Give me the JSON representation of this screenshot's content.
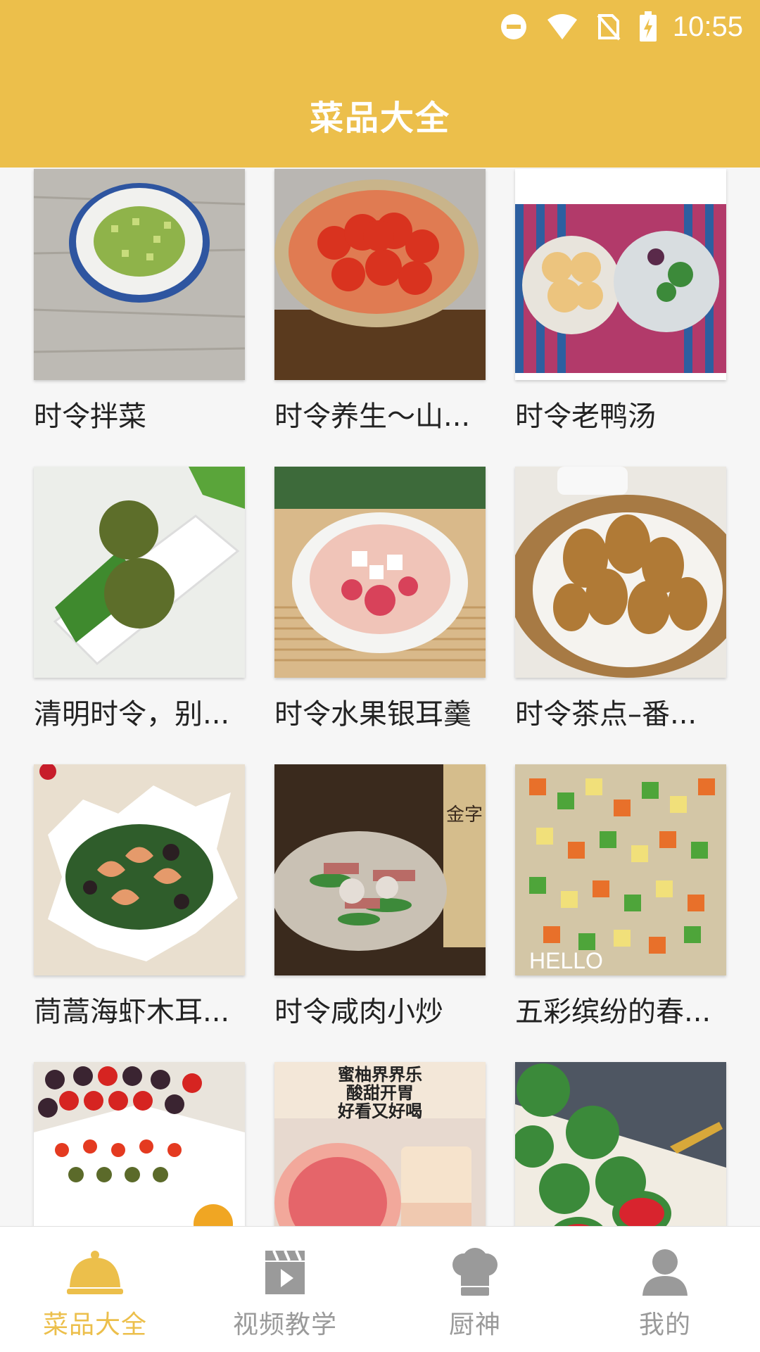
{
  "status_bar": {
    "time": "10:55"
  },
  "header": {
    "title": "菜品大全"
  },
  "dishes": [
    {
      "name": "时令拌菜"
    },
    {
      "name": "时令养生～山..."
    },
    {
      "name": "时令老鸭汤"
    },
    {
      "name": "清明时令，别..."
    },
    {
      "name": "时令水果银耳羹"
    },
    {
      "name": "时令茶点–番..."
    },
    {
      "name": "茼蒿海虾木耳..."
    },
    {
      "name": "时令咸肉小炒"
    },
    {
      "name": "五彩缤纷的春..."
    },
    {
      "name": ""
    },
    {
      "name": ""
    },
    {
      "name": ""
    }
  ],
  "image_text": {
    "honey_pomelo_line1": "蜜柚界界乐",
    "honey_pomelo_line2": "酸甜开胃",
    "honey_pomelo_line3": "好看又好喝",
    "hello_watermark": "HELLO",
    "jinzi_label": "金字"
  },
  "bottom_nav": [
    {
      "label": "菜品大全",
      "icon": "cloche-icon",
      "active": true
    },
    {
      "label": "视频教学",
      "icon": "video-icon",
      "active": false
    },
    {
      "label": "厨神",
      "icon": "chef-hat-icon",
      "active": false
    },
    {
      "label": "我的",
      "icon": "person-icon",
      "active": false
    }
  ],
  "colors": {
    "accent": "#ecbf4b",
    "inactive": "#9a9a9a"
  }
}
